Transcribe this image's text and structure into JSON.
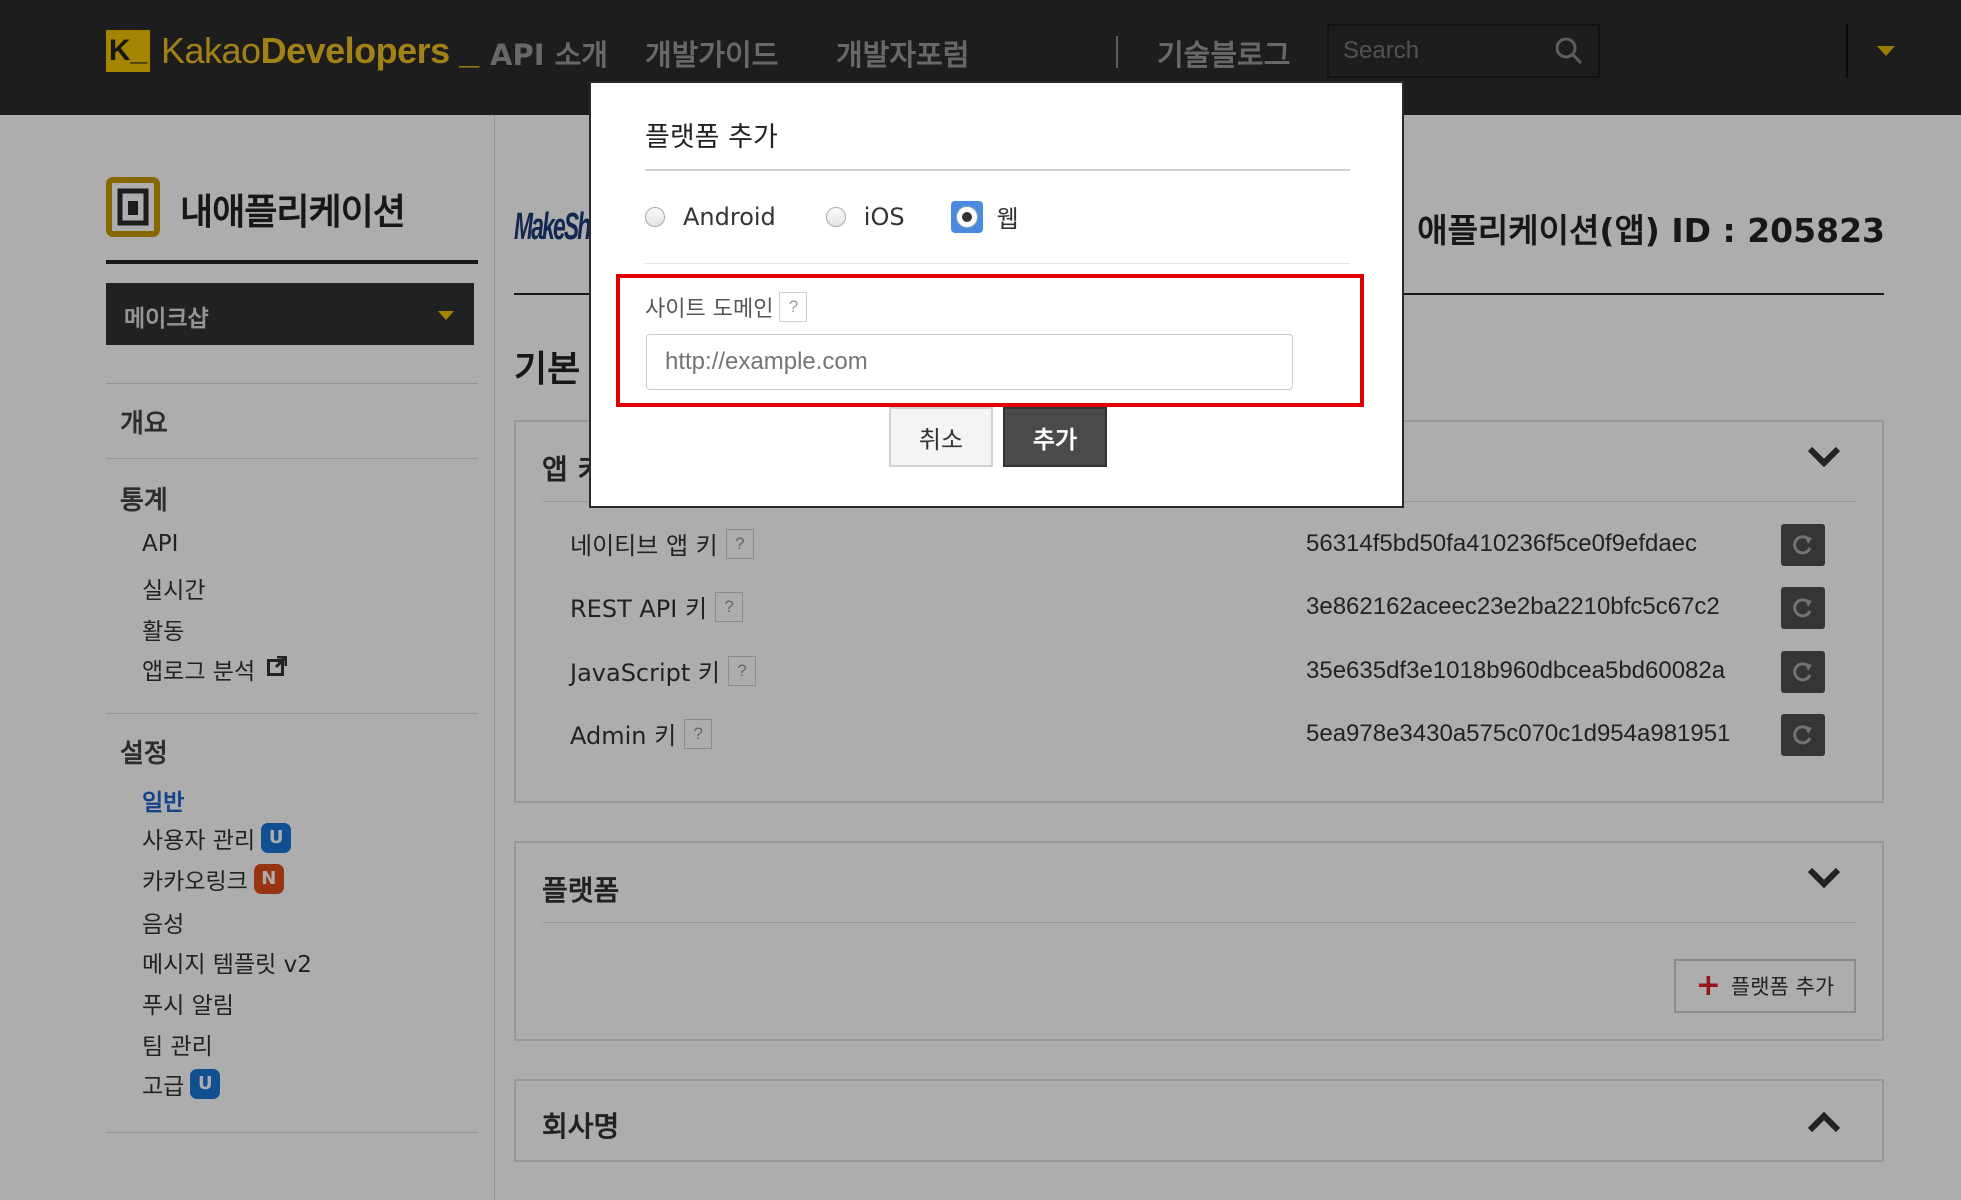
{
  "header": {
    "logo_mark": "K_",
    "logo_brand_part1": "Kakao",
    "logo_brand_part2": "Developers _",
    "nav": [
      "API 소개",
      "개발가이드",
      "개발자포럼"
    ],
    "nav_blog": "기술블로그",
    "search_placeholder": "Search",
    "accent_color": "#f2c300"
  },
  "sidebar": {
    "title": "내애플리케이션",
    "app_select": "메이크샵",
    "overview": "개요",
    "stats_heading": "통계",
    "stats_items": [
      "API",
      "실시간",
      "활동",
      "앱로그 분석"
    ],
    "settings_heading": "설정",
    "settings_items": [
      {
        "label": "일반",
        "badge": ""
      },
      {
        "label": "사용자 관리",
        "badge": "U"
      },
      {
        "label": "카카오링크",
        "badge": "N"
      },
      {
        "label": "음성",
        "badge": ""
      },
      {
        "label": "메시지 템플릿 v2",
        "badge": ""
      },
      {
        "label": "푸시 알림",
        "badge": ""
      },
      {
        "label": "팀 관리",
        "badge": ""
      },
      {
        "label": "고급",
        "badge": "U"
      }
    ]
  },
  "main": {
    "app_logo_text": "MakeShop",
    "app_id": "애플리케이션(앱) ID : 205823",
    "section_title": "기본",
    "app_keys_panel": {
      "title": "앱 키",
      "rows": [
        {
          "label": "네이티브 앱 키",
          "value": "56314f5bd50fa410236f5ce0f9efdaec"
        },
        {
          "label": "REST API 키",
          "value": "3e862162aceec23e2ba2210bfc5c67c2"
        },
        {
          "label": "JavaScript 키",
          "value": "35e635df3e1018b960dbcea5bd60082a"
        },
        {
          "label": "Admin 키",
          "value": "5ea978e3430a575c070c1d954a981951"
        }
      ]
    },
    "platform_panel": {
      "title": "플랫폼",
      "add_button": "플랫폼 추가"
    },
    "company_panel": {
      "title": "회사명"
    }
  },
  "modal": {
    "title": "플랫폼 추가",
    "radio_options": [
      "Android",
      "iOS",
      "웹"
    ],
    "selected_option": "웹",
    "domain_label": "사이트 도메인",
    "help": "?",
    "domain_placeholder": "http://example.com",
    "cancel_label": "취소",
    "add_label": "추가",
    "highlight_color": "#e00000"
  }
}
